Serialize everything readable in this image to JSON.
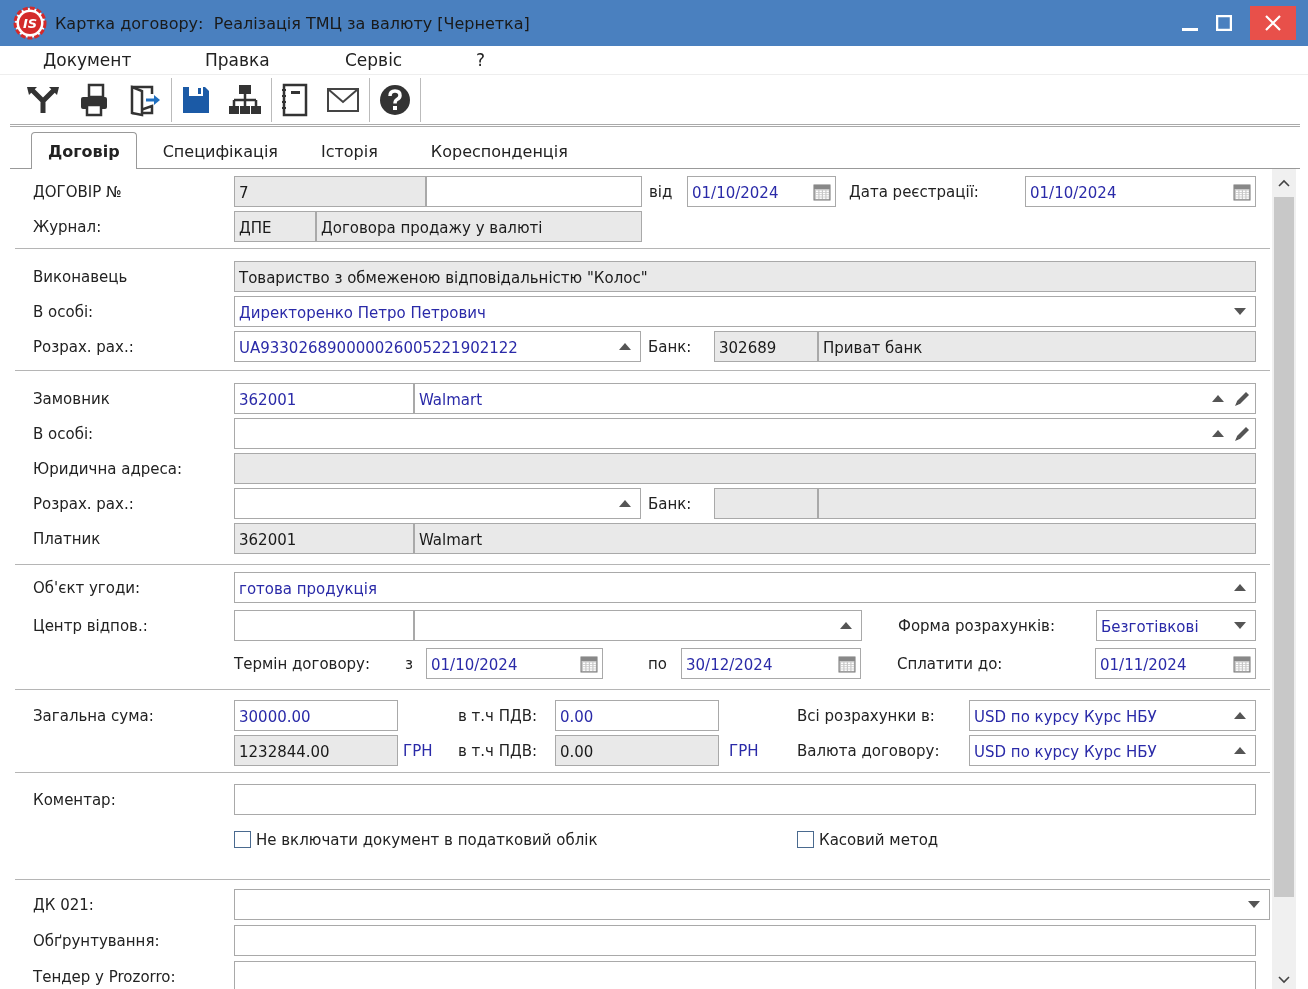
{
  "window": {
    "title": "Картка договору:  Реалізація ТМЦ за валюту [Чернетка]",
    "logo_text": "IS"
  },
  "menu": [
    "Документ",
    "Правка",
    "Сервіс",
    "?"
  ],
  "tabs": [
    {
      "label": "Договір",
      "selected": true
    },
    {
      "label": "Специфікація",
      "selected": false
    },
    {
      "label": "Історія",
      "selected": false
    },
    {
      "label": "Кореспонденція",
      "selected": false
    }
  ],
  "contract_number": {
    "label": "ДОГОВІР №",
    "code": {
      "value": "7",
      "readonly": true
    },
    "suffix": {
      "readonly": false
    }
  },
  "contract_date": {
    "label": "від",
    "field": {
      "value": "01/10/2024",
      "readonly": false,
      "kind": "date"
    }
  },
  "registration_date": {
    "label": "Дата реєстрації:",
    "field": {
      "value": "01/10/2024",
      "readonly": false,
      "kind": "date"
    }
  },
  "journal": {
    "label": "Журнал:",
    "code": {
      "value": "ДПЕ",
      "readonly": true
    },
    "name": {
      "value": "Договора продажу у валюті",
      "readonly": true
    }
  },
  "executor": {
    "label": "Виконавець",
    "field": {
      "value": "Товариство з обмеженою відповідальністю \"Колос\"",
      "readonly": true
    }
  },
  "executor_person": {
    "label": "В особі:",
    "field": {
      "value": "Директоренко Петро Петрович",
      "readonly": false,
      "kind": "combo-down"
    }
  },
  "executor_account": {
    "label": "Розрах. рах.:",
    "field": {
      "value": "UA933026890000026005221902122",
      "readonly": false,
      "kind": "combo-up"
    },
    "bank_label": "Банк:",
    "bank_code": {
      "value": "302689",
      "readonly": true
    },
    "bank_name": {
      "value": "Приват банк",
      "readonly": true
    }
  },
  "customer": {
    "label": "Замовник",
    "code": {
      "value": "362001",
      "readonly": false
    },
    "name": {
      "value": "Walmart",
      "readonly": false,
      "kind": "lookup"
    }
  },
  "customer_person": {
    "label": "В особі:",
    "field": {
      "readonly": false,
      "kind": "lookup"
    }
  },
  "legal_address": {
    "label": "Юридична адреса:",
    "field": {
      "readonly": true
    }
  },
  "customer_account": {
    "label": "Розрах. рах.:",
    "field": {
      "readonly": false,
      "kind": "combo-up"
    },
    "bank_label": "Банк:",
    "bank_code": {
      "readonly": true
    },
    "bank_name": {
      "readonly": true
    }
  },
  "payer": {
    "label": "Платник",
    "code": {
      "value": "362001",
      "readonly": true
    },
    "name": {
      "value": "Walmart",
      "readonly": true
    }
  },
  "subject": {
    "label": "Об'єкт угоди:",
    "field": {
      "value": "готова продукція",
      "readonly": false,
      "kind": "combo-up"
    }
  },
  "responsibility_center": {
    "label": "Центр відпов.:",
    "code": {
      "readonly": false
    },
    "name": {
      "readonly": false,
      "kind": "combo-up"
    }
  },
  "payment_form": {
    "label": "Форма розрахунків:",
    "field": {
      "value": "Безготівкові",
      "readonly": false,
      "kind": "combo-down"
    }
  },
  "term": {
    "label": "Термін договору:",
    "from_label": "з",
    "from": {
      "value": "01/10/2024",
      "readonly": false,
      "kind": "date"
    },
    "to_label": "по",
    "to": {
      "value": "30/12/2024",
      "readonly": false,
      "kind": "date"
    }
  },
  "pay_by": {
    "label": "Сплатити до:",
    "field": {
      "value": "01/11/2024",
      "readonly": false,
      "kind": "date"
    }
  },
  "total": {
    "label": "Загальна сума:",
    "amount": {
      "value": "30000.00",
      "readonly": false
    },
    "vat_label": "в т.ч ПДВ:",
    "vat": {
      "value": "0.00",
      "readonly": false
    }
  },
  "total_uah": {
    "amount": {
      "value": "1232844.00",
      "readonly": true
    },
    "currency": "ГРН",
    "vat_label": "в т.ч ПДВ:",
    "vat": {
      "value": "0.00",
      "readonly": true
    },
    "vat_currency": "ГРН"
  },
  "settlement_currency": {
    "label": "Всі розрахунки в:",
    "field": {
      "value": "USD по курсу Курс НБУ",
      "readonly": false,
      "kind": "combo-up"
    }
  },
  "contract_currency": {
    "label": "Валюта договору:",
    "field": {
      "value": "USD по курсу Курс НБУ",
      "readonly": false,
      "kind": "combo-up"
    }
  },
  "comment": {
    "label": "Коментар:",
    "field": {
      "readonly": false
    }
  },
  "checkboxes": [
    {
      "label": "Не включати документ в податковий облік",
      "checked": false
    },
    {
      "label": "Касовий метод",
      "checked": false
    }
  ],
  "dk021": {
    "label": "ДК 021:",
    "field": {
      "readonly": false,
      "kind": "combo-down"
    }
  },
  "justification": {
    "label": "Обґрунтування:",
    "field": {
      "readonly": false
    }
  },
  "tender": {
    "label": "Тендер у Prozorro:",
    "field": {
      "readonly": false
    }
  }
}
